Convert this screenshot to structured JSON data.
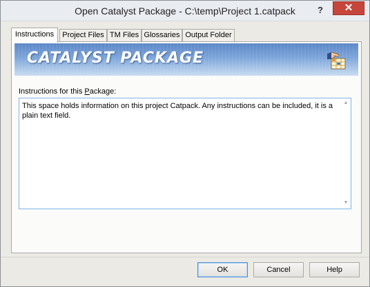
{
  "window": {
    "title": "Open Catalyst Package - C:\\temp\\Project 1.catpack",
    "help_glyph": "?",
    "close_glyph": "✕"
  },
  "tabs": [
    {
      "label": "Instructions",
      "active": true
    },
    {
      "label": "Project Files",
      "active": false
    },
    {
      "label": "TM Files",
      "active": false
    },
    {
      "label": "Glossaries",
      "active": false
    },
    {
      "label": "Output Folder",
      "active": false
    }
  ],
  "banner": {
    "title": "CATALYST PACKAGE",
    "icon": "package-hand-icon",
    "colors": {
      "top": "#5b87c7",
      "bottom": "#c9dbf1"
    }
  },
  "instructions": {
    "label_before": "Instructions for this ",
    "label_mnemonic": "P",
    "label_after": "ackage:",
    "text": "This space holds information on this project Catpack. Any instructions can be included, it is a plain text field."
  },
  "buttons": {
    "ok": "OK",
    "cancel": "Cancel",
    "help": "Help"
  },
  "colors": {
    "accent": "#4a8fd8",
    "close": "#c7463c"
  }
}
